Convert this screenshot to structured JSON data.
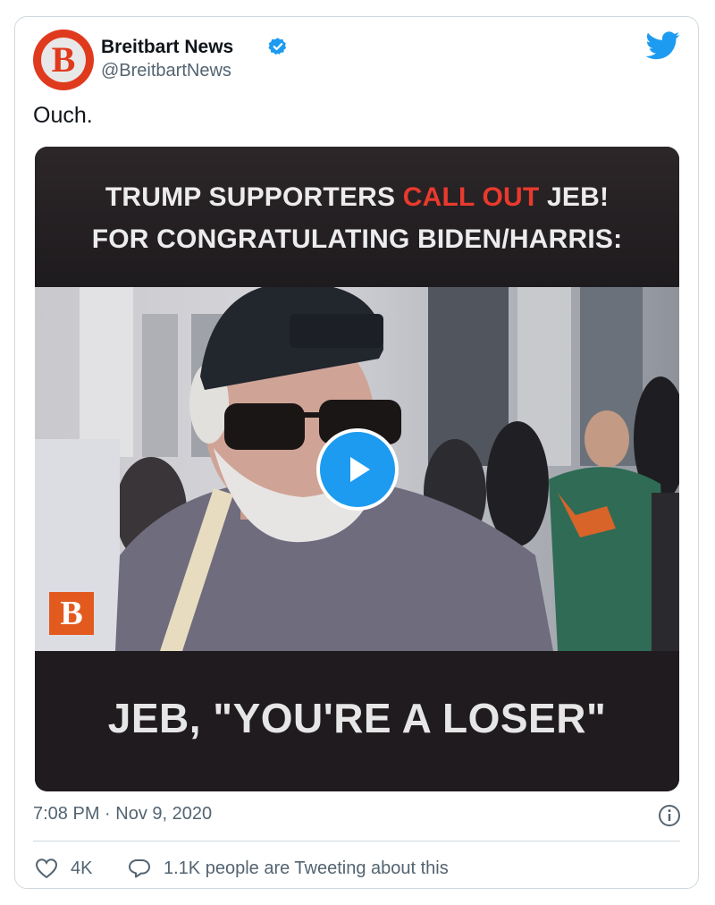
{
  "author": {
    "name": "Breitbart News",
    "handle": "@BreitbartNews",
    "avatar_letter": "B",
    "verified": true,
    "brand_color": "#e03a1e"
  },
  "tweet": {
    "text": "Ouch.",
    "timestamp": "7:08 PM · Nov 9, 2020"
  },
  "media": {
    "headline_part1": "TRUMP SUPPORTERS ",
    "headline_highlight": "CALL OUT",
    "headline_part2": " JEB!",
    "headline_line2": "FOR CONGRATULATING BIDEN/HARRIS:",
    "caption": "JEB, \"YOU'RE A LOSER\"",
    "watermark_letter": "B",
    "highlight_color": "#e83a2d"
  },
  "actions": {
    "likes": "4K",
    "tweeting": "1.1K people are Tweeting about this"
  },
  "icons": {
    "platform": "twitter-bird-icon",
    "play": "play-icon",
    "info": "info-icon",
    "like": "heart-icon",
    "reply": "speech-bubble-icon"
  },
  "colors": {
    "twitter_blue": "#1d9bf0",
    "secondary_text": "#536471",
    "border": "#cfd9de"
  }
}
